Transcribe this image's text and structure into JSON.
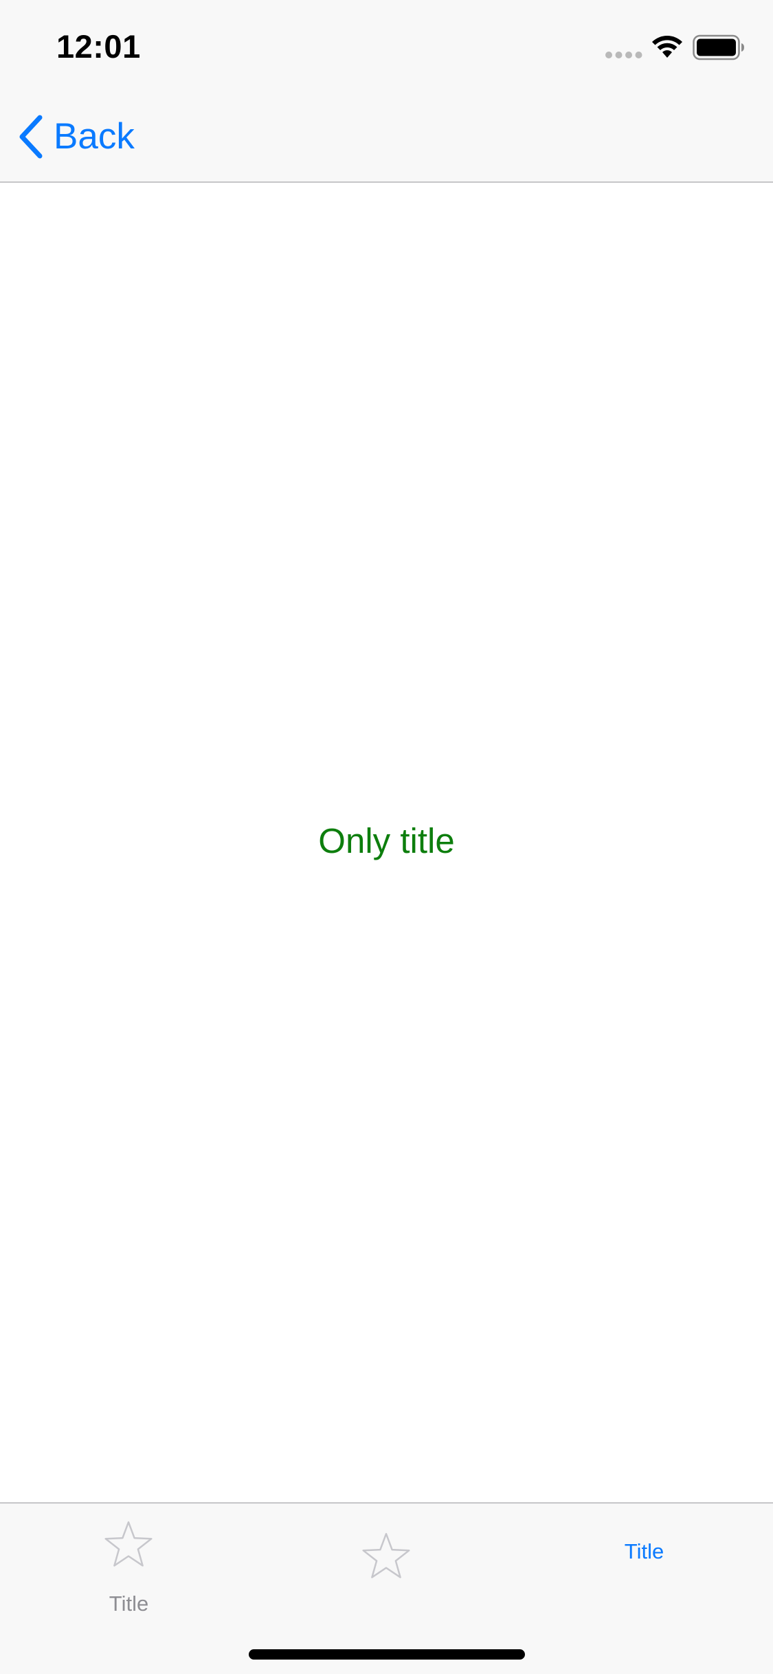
{
  "status_bar": {
    "time": "12:01",
    "signal_icon": "signal-dots-icon",
    "wifi_icon": "wifi-icon",
    "battery_icon": "battery-icon"
  },
  "nav_bar": {
    "back_label": "Back",
    "back_icon": "chevron-left-icon"
  },
  "content": {
    "title": "Only title"
  },
  "tab_bar": {
    "items": [
      {
        "label": "Title",
        "icon": "star-outline-icon",
        "selected": false
      },
      {
        "label": "",
        "icon": "star-outline-icon",
        "selected": false
      },
      {
        "label": "Title",
        "icon": "",
        "selected": true
      }
    ]
  },
  "colors": {
    "accent": "#0a7aff",
    "title_green": "#0d7e0d",
    "bar_background": "#f8f8f8",
    "inactive_tab": "#8e8e93",
    "separator": "#c6c6c8"
  }
}
